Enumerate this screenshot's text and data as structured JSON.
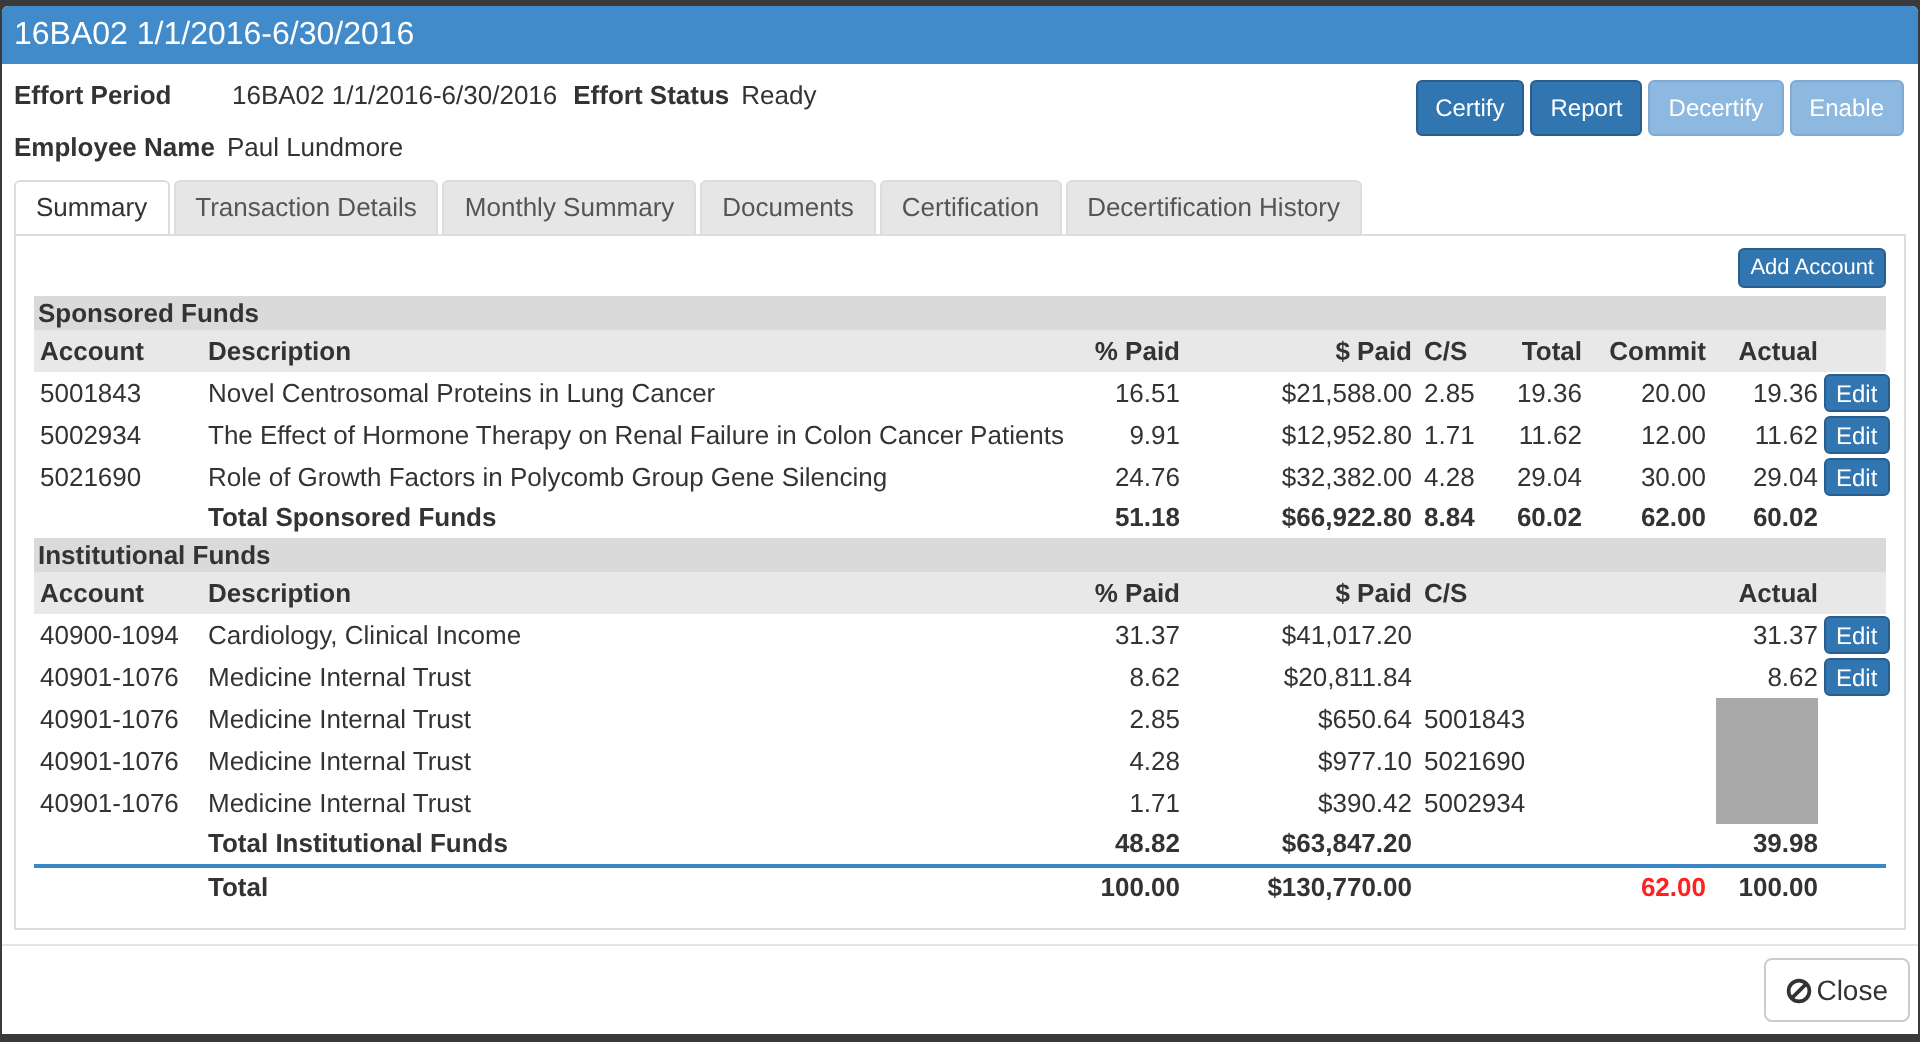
{
  "window": {
    "title": "16BA02 1/1/2016-6/30/2016"
  },
  "info": [
    {
      "label": "Effort Period",
      "value": "16BA02 1/1/2016-6/30/2016"
    },
    {
      "label": "Effort Status",
      "value": "Ready"
    },
    {
      "label": "Employee Name",
      "value": "Paul Lundmore"
    }
  ],
  "actions": [
    {
      "label": "Certify",
      "disabled": false
    },
    {
      "label": "Report",
      "disabled": false
    },
    {
      "label": "Decertify",
      "disabled": true
    },
    {
      "label": "Enable",
      "disabled": true
    }
  ],
  "tabs": [
    {
      "label": "Summary",
      "selected": true
    },
    {
      "label": "Transaction Details",
      "selected": false
    },
    {
      "label": "Monthly Summary",
      "selected": false
    },
    {
      "label": "Documents",
      "selected": false
    },
    {
      "label": "Certification",
      "selected": false
    },
    {
      "label": "Decertification History",
      "selected": false
    }
  ],
  "add_account": "Add Account",
  "sections": [
    {
      "title": "Sponsored Funds",
      "columns": {
        "account": "Account",
        "description": "Description",
        "pct_paid": "% Paid",
        "paid": "$ Paid",
        "cs": "C/S",
        "total": "Total",
        "commit": "Commit",
        "actual": "Actual"
      },
      "rows": [
        {
          "account": "5001843",
          "description": "Novel Centrosomal Proteins in Lung Cancer",
          "pct_paid": "16.51",
          "paid": "$21,588.00",
          "cs": "2.85",
          "total": "19.36",
          "commit": "20.00",
          "actual": "19.36",
          "action": "Edit",
          "masked": false
        },
        {
          "account": "5002934",
          "description": "The Effect of Hormone Therapy on Renal Failure in Colon Cancer Patients",
          "pct_paid": "9.91",
          "paid": "$12,952.80",
          "cs": "1.71",
          "total": "11.62",
          "commit": "12.00",
          "actual": "11.62",
          "action": "Edit",
          "masked": false
        },
        {
          "account": "5021690",
          "description": "Role of Growth Factors in Polycomb Group Gene Silencing",
          "pct_paid": "24.76",
          "paid": "$32,382.00",
          "cs": "4.28",
          "total": "29.04",
          "commit": "30.00",
          "actual": "29.04",
          "action": "Edit",
          "masked": false
        }
      ],
      "total": {
        "description": "Total Sponsored Funds",
        "pct_paid": "51.18",
        "paid": "$66,922.80",
        "cs": "8.84",
        "total": "60.02",
        "commit": "62.00",
        "actual": "60.02"
      }
    },
    {
      "title": "Institutional Funds",
      "columns": {
        "account": "Account",
        "description": "Description",
        "pct_paid": "% Paid",
        "paid": "$ Paid",
        "cs": "C/S",
        "actual": "Actual"
      },
      "rows": [
        {
          "account": "40900-1094",
          "description": "Cardiology, Clinical Income",
          "pct_paid": "31.37",
          "paid": "$41,017.20",
          "actual": "31.37",
          "action": "Edit",
          "masked": false
        },
        {
          "account": "40901-1076",
          "description": "Medicine Internal Trust",
          "pct_paid": "8.62",
          "paid": "$20,811.84",
          "actual": "8.62",
          "action": "Edit",
          "masked": false
        },
        {
          "account": "40901-1076",
          "description": "Medicine Internal Trust",
          "pct_paid": "2.85",
          "paid": "$650.64",
          "cs": "5001843",
          "masked": true
        },
        {
          "account": "40901-1076",
          "description": "Medicine Internal Trust",
          "pct_paid": "4.28",
          "paid": "$977.10",
          "cs": "5021690",
          "masked": true
        },
        {
          "account": "40901-1076",
          "description": "Medicine Internal Trust",
          "pct_paid": "1.71",
          "paid": "$390.42",
          "cs": "5002934",
          "masked": true
        }
      ],
      "total": {
        "description": "Total Institutional Funds",
        "pct_paid": "48.82",
        "paid": "$63,847.20",
        "actual": "39.98"
      }
    }
  ],
  "grand_total": {
    "description": "Total",
    "pct_paid": "100.00",
    "paid": "$130,770.00",
    "commit": "62.00",
    "actual": "100.00",
    "commit_alert": true
  },
  "close": "Close"
}
